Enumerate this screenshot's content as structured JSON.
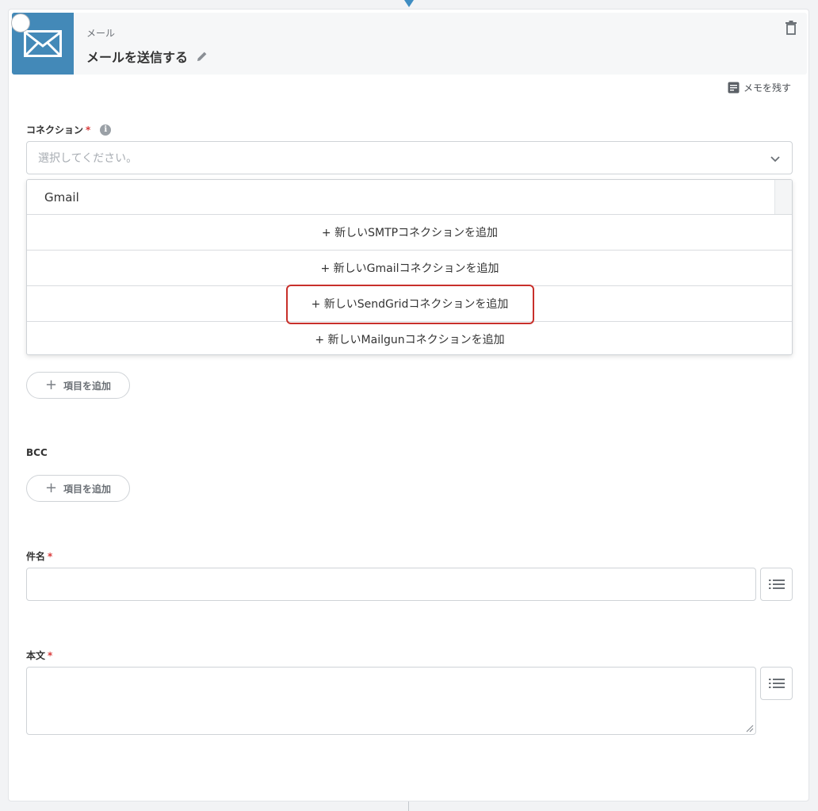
{
  "header": {
    "subtitle": "メール",
    "title": "メールを送信する"
  },
  "memo_label": "メモを残す",
  "connection": {
    "label": "コネクション",
    "required_mark": "*",
    "info_glyph": "i",
    "placeholder": "選択してください。"
  },
  "dropdown": {
    "options": [
      "Gmail"
    ],
    "add_actions": [
      "+ 新しいSMTPコネクションを追加",
      "+ 新しいGmailコネクションを追加",
      "+ 新しいSendGridコネクションを追加",
      "+ 新しいMailgunコネクションを追加"
    ]
  },
  "add_item_label": "項目を追加",
  "bcc": {
    "label": "BCC"
  },
  "subject": {
    "label": "件名",
    "required_mark": "*"
  },
  "body": {
    "label": "本文",
    "required_mark": "*"
  },
  "colors": {
    "accent": "#4389b8",
    "required": "#d93a3a",
    "highlight": "#c8302b"
  }
}
